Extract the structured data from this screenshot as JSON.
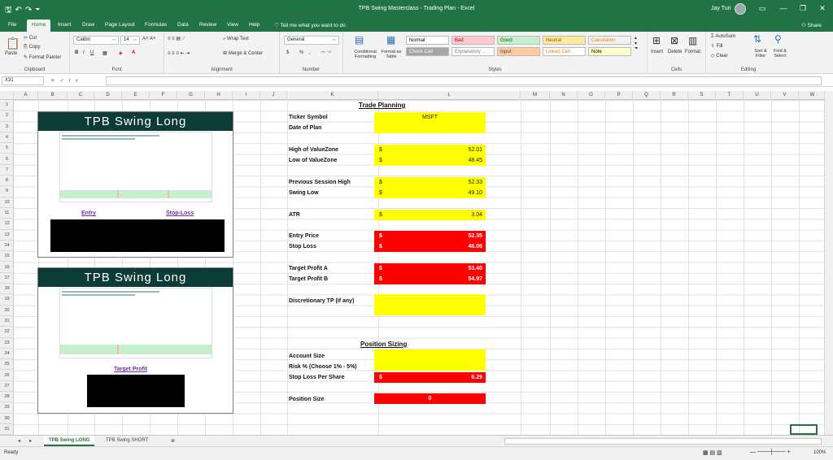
{
  "window": {
    "title": "TPB Swing Masterclass - Trading Plan - Excel",
    "user": "Jay Turi",
    "qat_icons": [
      "save-icon",
      "undo-icon",
      "redo-icon",
      "customize-icon"
    ]
  },
  "tabs": [
    "File",
    "Home",
    "Insert",
    "Draw",
    "Page Layout",
    "Formulas",
    "Data",
    "Review",
    "View",
    "Help"
  ],
  "active_tab": "Home",
  "tell_me": "Tell me what you want to do",
  "share": "Share",
  "ribbon": {
    "clipboard": {
      "paste": "Paste",
      "cut": "Cut",
      "copy": "Copy",
      "format_painter": "Format Painter",
      "label": "Clipboard"
    },
    "font": {
      "name": "Calibri",
      "size": "14",
      "label": "Font"
    },
    "alignment": {
      "wrap": "Wrap Text",
      "merge": "Merge & Center",
      "label": "Alignment"
    },
    "number": {
      "format": "General",
      "currency": "$",
      "percent": "%",
      "comma": ",",
      "label": "Number"
    },
    "styles": {
      "conditional": "Conditional Formatting",
      "format_table": "Format as Table",
      "cells": [
        {
          "text": "Normal",
          "bg": "#ffffff",
          "fg": "#000000"
        },
        {
          "text": "Bad",
          "bg": "#ffc7ce",
          "fg": "#9c0006"
        },
        {
          "text": "Good",
          "bg": "#c6efce",
          "fg": "#006100"
        },
        {
          "text": "Neutral",
          "bg": "#ffeb9c",
          "fg": "#9c5700"
        },
        {
          "text": "Calculation",
          "bg": "#f2f2f2",
          "fg": "#fa7d00"
        },
        {
          "text": "Check Cell",
          "bg": "#a5a5a5",
          "fg": "#ffffff"
        },
        {
          "text": "Explanatory ...",
          "bg": "#ffffff",
          "fg": "#7f7f7f"
        },
        {
          "text": "Input",
          "bg": "#ffcc99",
          "fg": "#3f3f76"
        },
        {
          "text": "Linked Cell",
          "bg": "#ffffff",
          "fg": "#fa7d00"
        },
        {
          "text": "Note",
          "bg": "#ffffcc",
          "fg": "#000000"
        }
      ],
      "label": "Styles"
    },
    "cells": {
      "insert": "Insert",
      "delete": "Delete",
      "format": "Format",
      "label": "Cells"
    },
    "editing": {
      "autosum": "AutoSum",
      "fill": "Fill",
      "clear": "Clear",
      "sort": "Sort & Filter",
      "find": "Find & Select",
      "label": "Editing"
    }
  },
  "name_box": "X31",
  "columns": [
    "A",
    "B",
    "C",
    "D",
    "E",
    "F",
    "G",
    "H",
    "I",
    "J",
    "K",
    "L",
    "M",
    "N",
    "O",
    "P",
    "Q",
    "R",
    "S",
    "T",
    "U",
    "V",
    "W",
    "X"
  ],
  "rows": [
    "1",
    "2",
    "3",
    "4",
    "5",
    "6",
    "7",
    "8",
    "9",
    "10",
    "11",
    "12",
    "13",
    "14",
    "15",
    "16",
    "17",
    "18",
    "19",
    "20",
    "21",
    "22",
    "23",
    "24",
    "25",
    "26",
    "27",
    "28",
    "29",
    "30",
    "31"
  ],
  "trade_planning": {
    "header": "Trade Planning",
    "ticker_label": "Ticker Symbol",
    "ticker": "MSFT",
    "date_label": "Date of Plan",
    "high_vz_label": "High of ValueZone",
    "high_vz": "52.01",
    "low_vz_label": "Low of ValueZone",
    "low_vz": "48.45",
    "prev_high_label": "Previous Session High",
    "prev_high": "52.33",
    "swing_low_label": "Swing Low",
    "swing_low": "49.10",
    "atr_label": "ATR",
    "atr": "3.04",
    "entry_label": "Entry Price",
    "entry": "52.35",
    "stop_label": "Stop Loss",
    "stop": "46.06",
    "tpa_label": "Target Profit A",
    "tpa": "53.40",
    "tpb_label": "Target Profit B",
    "tpb": "54.97",
    "disc_label": "Discretionary TP (if any)",
    "currency": "$"
  },
  "position_sizing": {
    "header": "Position Sizing",
    "account_label": "Account Size",
    "risk_label": "Risk % (Choose 1% - 5%)",
    "slps_label": "Stop Loss Per Share",
    "slps": "6.29",
    "size_label": "Position Size",
    "size": "0"
  },
  "panels": {
    "title": "TPB Swing Long",
    "entry_link": "Entry",
    "stop_link": "Stop-Loss",
    "target_link": "Target Profit"
  },
  "sheets": [
    "TPB Swing LONG",
    "TPB Swing SHORT"
  ],
  "active_sheet": "TPB Swing LONG",
  "status": "Ready",
  "zoom": "100%"
}
